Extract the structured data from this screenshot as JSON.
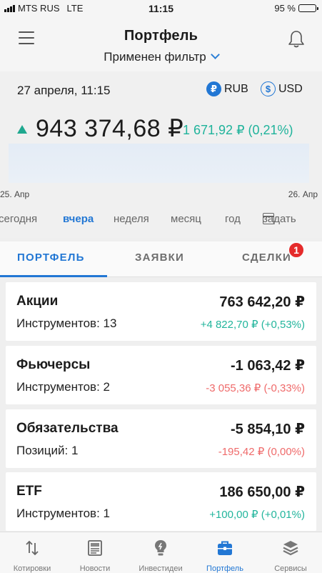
{
  "status_bar": {
    "carrier": "MTS RUS",
    "network": "LTE",
    "time": "11:15",
    "battery": "95 %"
  },
  "header": {
    "title": "Портфель",
    "filter": "Применен фильтр"
  },
  "summary": {
    "date": "27 апреля, 11:15",
    "currencies": [
      {
        "symbol": "₽",
        "label": "RUB",
        "selected": true
      },
      {
        "symbol": "$",
        "label": "USD",
        "selected": false
      }
    ],
    "total": "943 374,68 ₽",
    "change": "1 671,92 ₽ (0,21%)",
    "chart_start": "25. Апр",
    "chart_end": "26. Апр",
    "periods": [
      "сегодня",
      "вчера",
      "неделя",
      "месяц",
      "год",
      "задать"
    ],
    "active_period": "вчера"
  },
  "tabs": [
    {
      "label": "ПОРТФЕЛЬ",
      "active": true
    },
    {
      "label": "ЗАЯВКИ",
      "active": false
    },
    {
      "label": "СДЕЛКИ",
      "active": false,
      "badge": "1"
    }
  ],
  "cards": [
    {
      "name": "Акции",
      "count": "Инструментов: 13",
      "value": "763 642,20 ₽",
      "change": "+4 822,70 ₽ (+0,53%)",
      "trend": "pos"
    },
    {
      "name": "Фьючерсы",
      "count": "Инструментов: 2",
      "value": "-1 063,42 ₽",
      "change": "-3 055,36 ₽ (-0,33%)",
      "trend": "neg"
    },
    {
      "name": "Обязательства",
      "count": "Позиций: 1",
      "value": "-5 854,10 ₽",
      "change": "-195,42 ₽ (0,00%)",
      "trend": "neg"
    },
    {
      "name": "ETF",
      "count": "Инструментов: 1",
      "value": "186 650,00 ₽",
      "change": "+100,00 ₽ (+0,01%)",
      "trend": "pos"
    }
  ],
  "bottom_nav": [
    {
      "label": "Котировки",
      "icon": "arrows-updown-icon"
    },
    {
      "label": "Новости",
      "icon": "newspaper-icon"
    },
    {
      "label": "Инвестидеи",
      "icon": "lightbulb-icon"
    },
    {
      "label": "Портфель",
      "icon": "briefcase-icon",
      "active": true
    },
    {
      "label": "Сервисы",
      "icon": "layers-icon"
    }
  ],
  "colors": {
    "accent": "#2277d4",
    "positive": "#22b59c",
    "negative": "#ef6a6a",
    "badge": "#e52b2b"
  }
}
